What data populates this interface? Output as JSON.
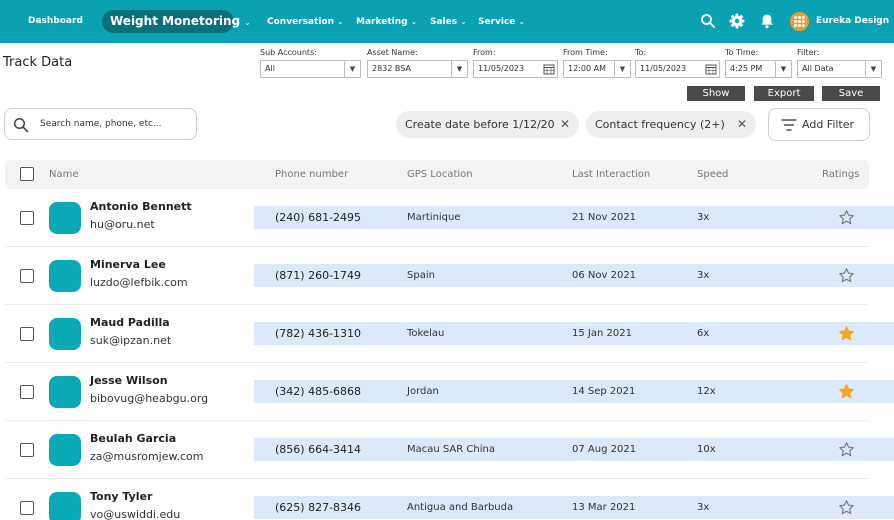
{
  "nav": {
    "dashboard": "Dashboard",
    "active": "Weight Monetoring",
    "items": [
      "Conversation",
      "Marketing",
      "Sales",
      "Service"
    ],
    "brand": "Eureka Design",
    "chevron": "⌄"
  },
  "toolbar": {
    "title": "Track Data",
    "filters": {
      "sub_accounts": {
        "label": "Sub Accounts:",
        "value": "All"
      },
      "asset_name": {
        "label": "Asset Name:",
        "value": "2832 BSA"
      },
      "from": {
        "label": "From:",
        "value": "11/05/2023"
      },
      "from_time": {
        "label": "From Time:",
        "value": "12:00 AM"
      },
      "to": {
        "label": "To:",
        "value": "11/05/2023"
      },
      "to_time": {
        "label": "To Time:",
        "value": "4:25 PM"
      },
      "filter": {
        "label": "Filter:",
        "value": "All Data"
      }
    },
    "show_label": "Show",
    "export_label": "Export",
    "save_label": "Save"
  },
  "search": {
    "placeholder": "Search name, phone, etc..."
  },
  "chips": [
    {
      "label": "Create date before 1/12/20"
    },
    {
      "label": "Contact frequency (2+)"
    }
  ],
  "add_filter_label": "Add Filter",
  "table": {
    "columns": {
      "name": "Name",
      "phone": "Phone number",
      "gps": "GPS Location",
      "last": "Last Interaction",
      "speed": "Speed",
      "ratings": "Ratings"
    },
    "rows": [
      {
        "name": "Antonio Bennett",
        "email": "hu@oru.net",
        "phone": "(240) 681-2495",
        "gps": "Martinique",
        "last": "21 Nov 2021",
        "speed": "3x",
        "starred": false
      },
      {
        "name": "Minerva Lee",
        "email": "luzdo@lefbik.com",
        "phone": "(871) 260-1749",
        "gps": "Spain",
        "last": "06 Nov 2021",
        "speed": "3x",
        "starred": false
      },
      {
        "name": "Maud Padilla",
        "email": "suk@ipzan.net",
        "phone": "(782) 436-1310",
        "gps": "Tokelau",
        "last": "15 Jan 2021",
        "speed": "6x",
        "starred": true
      },
      {
        "name": "Jesse Wilson",
        "email": "bibovug@heabgu.org",
        "phone": "(342) 485-6868",
        "gps": "Jordan",
        "last": "14 Sep 2021",
        "speed": "12x",
        "starred": true
      },
      {
        "name": "Beulah Garcia",
        "email": "za@musromjew.com",
        "phone": "(856) 664-3414",
        "gps": "Macau SAR China",
        "last": "07 Aug 2021",
        "speed": "10x",
        "starred": false
      },
      {
        "name": "Tony Tyler",
        "email": "vo@uswiddi.edu",
        "phone": "(625) 827-8346",
        "gps": "Antigua and Barbuda",
        "last": "13 Mar 2021",
        "speed": "3x",
        "starred": false
      }
    ]
  },
  "colors": {
    "nav_bg": "#0aa2b3",
    "nav_active_bg": "#0c6f7c",
    "avatar": "#0aa9b5",
    "row_band": "#dce9fa",
    "star_filled": "#f5a623",
    "brand_logo": "#f29a2e"
  },
  "icons": {
    "search": "search-icon",
    "settings": "gear-icon",
    "notifications": "bell-icon",
    "filter": "filter-lines-icon",
    "calendar": "calendar-icon",
    "rating": "star-icon"
  }
}
